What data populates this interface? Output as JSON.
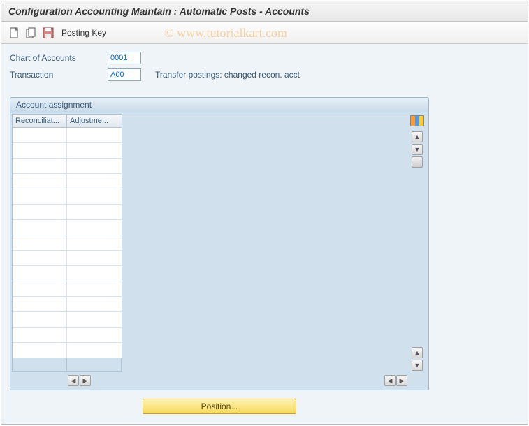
{
  "title": "Configuration Accounting Maintain : Automatic Posts - Accounts",
  "watermark": "© www.tutorialkart.com",
  "toolbar": {
    "posting_key_label": "Posting Key"
  },
  "form": {
    "chart_of_accounts_label": "Chart of Accounts",
    "chart_of_accounts_value": "0001",
    "transaction_label": "Transaction",
    "transaction_value": "A00",
    "transaction_desc": "Transfer postings: changed recon. acct"
  },
  "panel": {
    "header": "Account assignment",
    "columns": [
      "Reconciliat...",
      "Adjustme..."
    ],
    "row_count": 15
  },
  "buttons": {
    "position": "Position..."
  }
}
